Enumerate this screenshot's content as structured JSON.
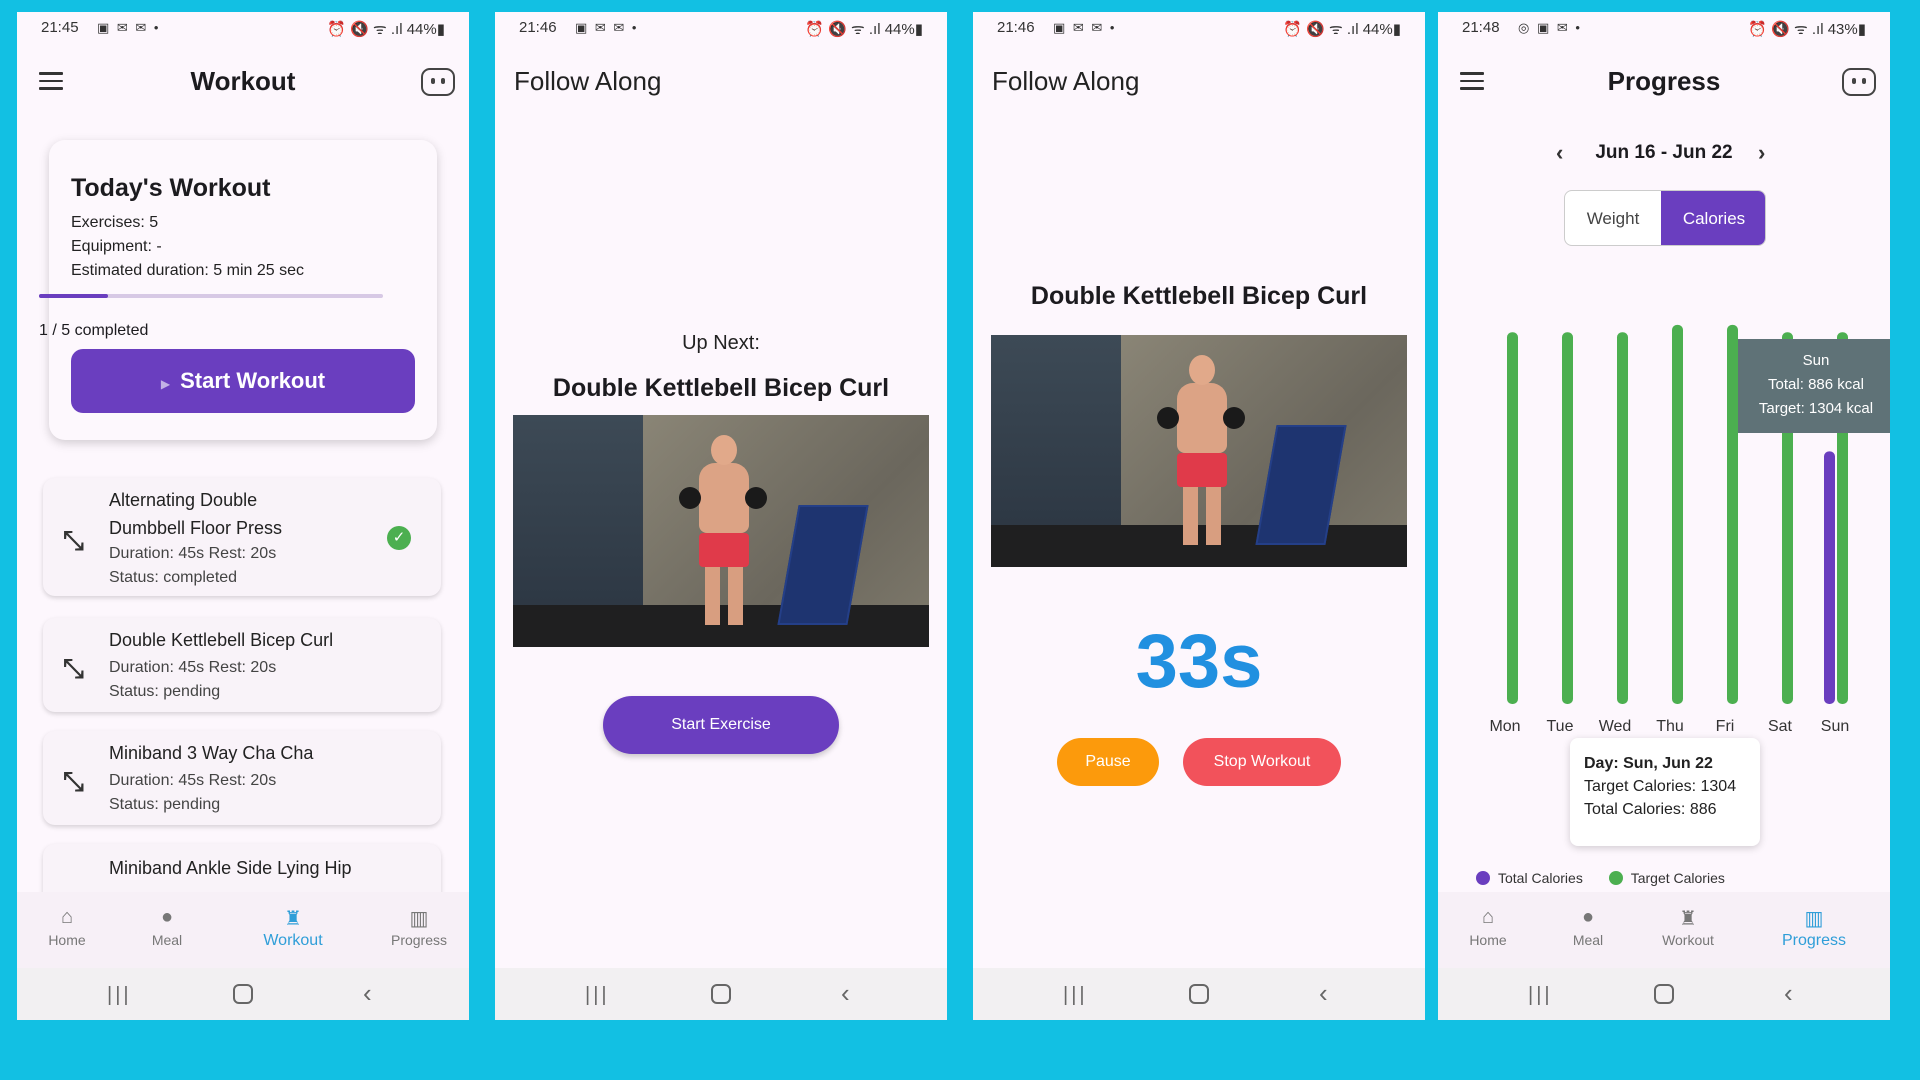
{
  "colors": {
    "accent": "#6a3ebf",
    "green": "#4caf50",
    "blue": "#2190e0",
    "pause": "#fc9a0c",
    "stop": "#f2525b",
    "background": "#12c0e3"
  },
  "screen1": {
    "status_time": "21:45",
    "status_right": "44%",
    "title": "Workout",
    "card": {
      "heading": "Today's Workout",
      "exercises": "Exercises: 5",
      "equipment": "Equipment: -",
      "duration": "Estimated duration: 5 min 25 sec",
      "progress_fraction": 0.2,
      "completed": "1 / 5 completed",
      "start_label": "Start Workout"
    },
    "exercises": [
      {
        "name_line1": "Alternating Double",
        "name_line2": "Dumbbell Floor Press",
        "meta": "Duration: 45s  Rest: 20s",
        "status": "Status: completed"
      },
      {
        "name_line1": "Double Kettlebell Bicep Curl",
        "meta": "Duration: 45s  Rest: 20s",
        "status": "Status: pending"
      },
      {
        "name_line1": "Miniband 3 Way Cha Cha",
        "meta": "Duration: 45s  Rest: 20s",
        "status": "Status: pending"
      },
      {
        "name_line1": "Miniband Ankle Side Lying Hip"
      }
    ],
    "nav": [
      "Home",
      "Meal",
      "Workout",
      "Progress"
    ]
  },
  "screen2": {
    "status_time": "21:46",
    "status_right": "44%",
    "title": "Follow Along",
    "up_next": "Up Next:",
    "exercise": "Double Kettlebell Bicep Curl",
    "start_label": "Start Exercise"
  },
  "screen3": {
    "status_time": "21:46",
    "status_right": "44%",
    "title": "Follow Along",
    "exercise": "Double Kettlebell Bicep Curl",
    "timer": "33s",
    "pause_label": "Pause",
    "stop_label": "Stop Workout"
  },
  "screen4": {
    "status_time": "21:48",
    "status_right": "43%",
    "title": "Progress",
    "date_range": "Jun 16 - Jun 22",
    "seg_weight": "Weight",
    "seg_calories": "Calories",
    "tooltip_day": "Sun",
    "tooltip_total": "Total: 886 kcal",
    "tooltip_target": "Target: 1304 kcal",
    "detail_day": "Day: Sun, Jun 22",
    "detail_target": "Target Calories: 1304",
    "detail_total": "Total Calories: 886",
    "legend_total": "Total Calories",
    "legend_target": "Target Calories",
    "nav": [
      "Home",
      "Meal",
      "Workout",
      "Progress"
    ]
  },
  "chart_data": {
    "type": "bar",
    "categories": [
      "Mon",
      "Tue",
      "Wed",
      "Thu",
      "Fri",
      "Sat",
      "Sun"
    ],
    "series": [
      {
        "name": "Target Calories",
        "values": [
          1304,
          1304,
          1304,
          1330,
          1330,
          1304,
          1304
        ]
      },
      {
        "name": "Total Calories",
        "values": [
          0,
          0,
          0,
          0,
          0,
          0,
          886
        ]
      }
    ],
    "ylim": [
      0,
      1340
    ],
    "legend": "bottom"
  }
}
